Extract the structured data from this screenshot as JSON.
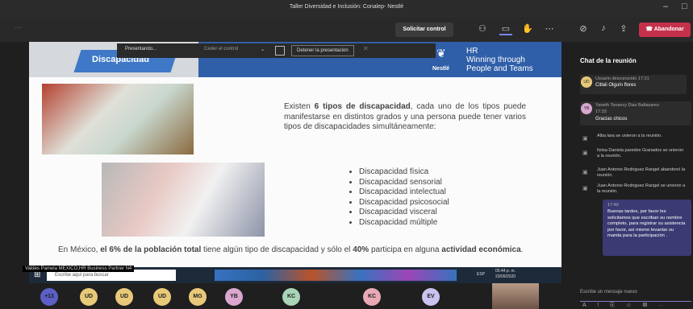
{
  "window": {
    "title": "Taller Diversidad e Inclusión: Conalep- Nestlé"
  },
  "toolbar": {
    "dots_left": "····",
    "request_control": "Solicitar control",
    "leave": "Abandonar"
  },
  "presenting_bar": {
    "presenting": "Presentando...",
    "give_control": "Ceder el control",
    "stop": "Detener la presentación"
  },
  "slide": {
    "heading": "Discapacidad",
    "brand": "Nestlé",
    "hr_lines": [
      "HR",
      "Winning through",
      "People and Teams"
    ],
    "intro_prefix": "Existen ",
    "intro_bold": "6 tipos de discapacidad",
    "intro_rest": ", cada uno de los tipos puede manifestarse en distintos grados y una persona puede tener varios tipos de discapacidades simultáneamente:",
    "bullets": [
      "Discapacidad física",
      "Discapacidad sensorial",
      "Discapacidad intelectual",
      "Discapacidad psicosocial",
      "Discapacidad visceral",
      "Discapacidad múltiple"
    ],
    "bottom_a": "En México, ",
    "bottom_b": "el 6% de la población total",
    "bottom_c": " tiene algún tipo de discapacidad y sólo el ",
    "bottom_d": "40%",
    "bottom_e": " participa en alguna ",
    "bottom_f": "actividad económica",
    "bottom_g": "."
  },
  "caption": "Valdes Pamela MEXICO,HR Business Partner N4",
  "taskbar": {
    "search": "Escribe aquí para buscar",
    "time": "05:44 p. m.",
    "date": "23/09/2020",
    "lang": "ESP"
  },
  "participants": [
    {
      "initials": "+13",
      "color": "#5b5fc7"
    },
    {
      "initials": "UD",
      "color": "#e8c979"
    },
    {
      "initials": "UD",
      "color": "#e8c979"
    },
    {
      "initials": "UD",
      "color": "#e8c979"
    },
    {
      "initials": "MG",
      "color": "#e8c979"
    },
    {
      "initials": "YB",
      "color": "#d9a7cf"
    },
    {
      "initials": "KC",
      "color": "#a9d5b8"
    },
    {
      "initials": "KC",
      "color": "#e8a9b5"
    },
    {
      "initials": "EV",
      "color": "#c9c4ef"
    }
  ],
  "chat": {
    "title": "Chat de la reunión",
    "messages": [
      {
        "avatar": "UD",
        "sender": "Usuario desconocido",
        "time": "17:31",
        "text": "Citlali Olguín flores"
      },
      {
        "avatar": "YB",
        "sender": "Yaneth Tonancy Diaz Baltazares",
        "time": "17:33",
        "text": "Gracias chicos"
      }
    ],
    "events": [
      "Alba lara se unieron a la reunión.",
      "Itzisa Daniela paredes Granados se unieron a la reunión.",
      "Juan Antonio Rodriguez Rangel abandonó la reunión.",
      "Juan Antonio Rodriguez Rangel se unieron a la reunión."
    ],
    "last": {
      "time": "17:40",
      "text": "Buenas tardes, por favor les solicitamos que escriban su nombre completo, para registrar su asistencia por favor, así mismo levantar su manita para la participación ."
    },
    "input_placeholder": "Escribe un mensaje nuevo"
  }
}
